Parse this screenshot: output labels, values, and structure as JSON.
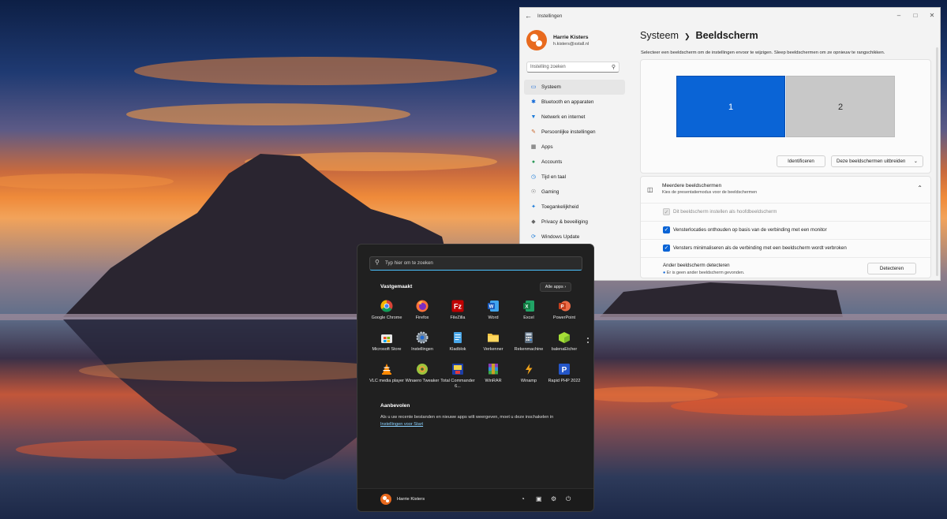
{
  "settings": {
    "window_title": "Instellingen",
    "user": {
      "name": "Harrie Kisters",
      "email": "h.kisters@xstall.nl"
    },
    "search_placeholder": "Instelling zoeken",
    "nav": [
      {
        "label": "Systeem",
        "icon": "monitor-icon",
        "active": true
      },
      {
        "label": "Bluetooth en apparaten",
        "icon": "bluetooth-icon"
      },
      {
        "label": "Netwerk en internet",
        "icon": "wifi-icon"
      },
      {
        "label": "Persoonlijke instellingen",
        "icon": "brush-icon"
      },
      {
        "label": "Apps",
        "icon": "apps-icon"
      },
      {
        "label": "Accounts",
        "icon": "person-icon"
      },
      {
        "label": "Tijd en taal",
        "icon": "globe-clock-icon"
      },
      {
        "label": "Gaming",
        "icon": "gamepad-icon"
      },
      {
        "label": "Toegankelijkheid",
        "icon": "accessibility-icon"
      },
      {
        "label": "Privacy & beveiliging",
        "icon": "shield-icon"
      },
      {
        "label": "Windows Update",
        "icon": "update-icon"
      }
    ],
    "breadcrumb": {
      "parent": "Systeem",
      "current": "Beeldscherm"
    },
    "description": "Selecteer een beeldscherm om de instellingen ervoor te wijzigen. Sleep beeldschermen om ze opnieuw te rangschikken.",
    "monitors": [
      "1",
      "2"
    ],
    "identify_label": "Identificeren",
    "extend_label": "Deze beeldschermen uitbreiden",
    "multi": {
      "title": "Meerdere beeldschermen",
      "subtitle": "Kies de presentatiemodus voor de beeldschermen",
      "options": [
        {
          "label": "Dit beeldscherm instellen als hoofdbeeldscherm",
          "checked": true,
          "disabled": true
        },
        {
          "label": "Vensterlocaties onthouden op basis van de verbinding met een monitor",
          "checked": true,
          "disabled": false
        },
        {
          "label": "Vensters minimaliseren als de verbinding met een beeldscherm wordt verbroken",
          "checked": true,
          "disabled": false
        }
      ],
      "detect_title": "Ander beeldscherm detecteren",
      "detect_status": "Er is geen ander beeldscherm gevonden.",
      "detect_button": "Detecteren"
    }
  },
  "start": {
    "search_placeholder": "Typ hier om te zoeken",
    "pinned_title": "Vastgemaakt",
    "all_apps": "Alle apps",
    "apps": [
      {
        "label": "Google Chrome",
        "icon": "chrome-icon"
      },
      {
        "label": "Firefox",
        "icon": "firefox-icon"
      },
      {
        "label": "FileZilla",
        "icon": "filezilla-icon"
      },
      {
        "label": "Word",
        "icon": "word-icon"
      },
      {
        "label": "Excel",
        "icon": "excel-icon"
      },
      {
        "label": "PowerPoint",
        "icon": "powerpoint-icon"
      },
      {
        "label": "Microsoft Store",
        "icon": "store-icon"
      },
      {
        "label": "Instellingen",
        "icon": "settings-gear-icon"
      },
      {
        "label": "Kladblok",
        "icon": "notepad-icon"
      },
      {
        "label": "Verkenner",
        "icon": "folder-icon"
      },
      {
        "label": "Rekenmachine",
        "icon": "calculator-icon"
      },
      {
        "label": "balenaEtcher",
        "icon": "etcher-icon"
      },
      {
        "label": "VLC media player",
        "icon": "vlc-icon"
      },
      {
        "label": "Winaero Tweaker",
        "icon": "winaero-icon"
      },
      {
        "label": "Total Commander 6...",
        "icon": "total-commander-icon"
      },
      {
        "label": "WinRAR",
        "icon": "winrar-icon"
      },
      {
        "label": "Winamp",
        "icon": "winamp-icon"
      },
      {
        "label": "Rapid PHP 2022",
        "icon": "rapid-php-icon"
      }
    ],
    "recommended_title": "Aanbevolen",
    "recommended_text": "Als u uw recente bestanden en nieuwe apps wilt weergeven, moet u deze inschakelen in",
    "recommended_link": "Instellingen voor Start",
    "user_name": "Harrie Kisters"
  },
  "colors": {
    "accent": "#0a64d6",
    "start_bg": "#202020",
    "settings_bg": "#f3f3f3",
    "link": "#8ad1ff"
  }
}
